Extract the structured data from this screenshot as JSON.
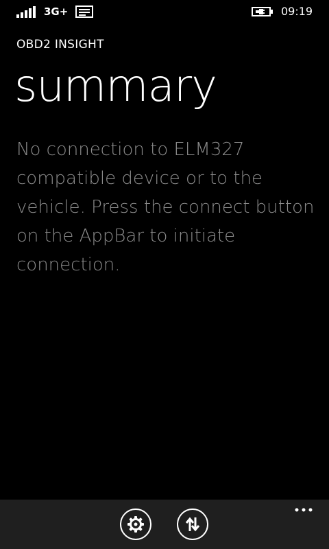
{
  "status_bar": {
    "network": "3G+",
    "time": "09:19",
    "icons": [
      "signal-strength-icon",
      "message-icon",
      "battery-charging-icon"
    ]
  },
  "header": {
    "app_title": "OBD2 INSIGHT",
    "page_title": "summary"
  },
  "main": {
    "message": "No connection to ELM327 compatible device or to the vehicle. Press the connect button on the AppBar to initiate connection."
  },
  "app_bar": {
    "buttons": [
      {
        "icon": "gear-icon"
      },
      {
        "icon": "connect-arrows-icon"
      }
    ],
    "more_icon": "ellipsis-icon"
  },
  "colors": {
    "background": "#000000",
    "foreground": "#ffffff",
    "subtle_text": "#8c8c8c",
    "app_bar": "#1f1f1f"
  }
}
